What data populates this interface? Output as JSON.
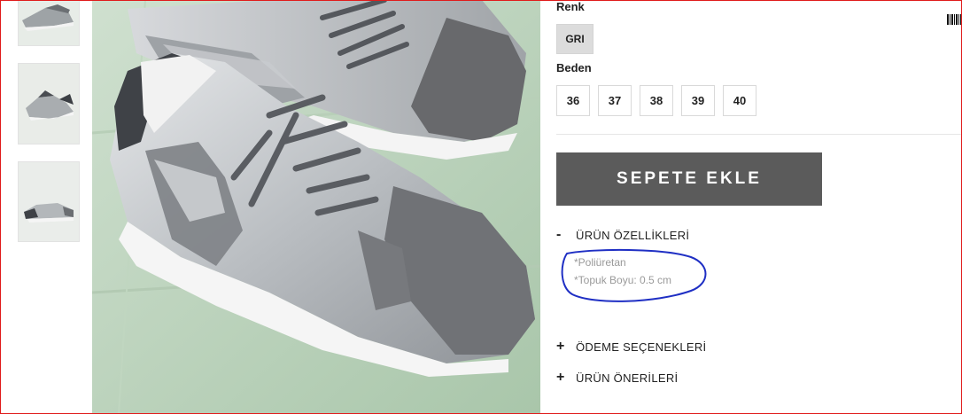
{
  "product": {
    "color_label": "Renk",
    "colors": [
      "GRI"
    ],
    "size_label": "Beden",
    "sizes": [
      "36",
      "37",
      "38",
      "39",
      "40"
    ],
    "add_to_cart": "SEPETE EKLE"
  },
  "accordion": [
    {
      "sign": "-",
      "title": "ÜRÜN ÖZELLİKLERİ",
      "expanded": true,
      "details": [
        "*Poliüretan",
        "*Topuk Boyu: 0.5 cm"
      ]
    },
    {
      "sign": "+",
      "title": "ÖDEME SEÇENEKLERİ",
      "expanded": false
    },
    {
      "sign": "+",
      "title": "ÜRÜN ÖNERİLERİ",
      "expanded": false
    }
  ],
  "gallery": {
    "thumbnails": [
      "shoe-thumbnail-1",
      "shoe-thumbnail-2",
      "shoe-thumbnail-3"
    ],
    "main_image": "silver-grey-sneaker-photo"
  },
  "colors": {
    "button_bg": "#5b5b5b",
    "annotation_circle": "#1f2fc4",
    "frame_border": "#e01b1b"
  }
}
